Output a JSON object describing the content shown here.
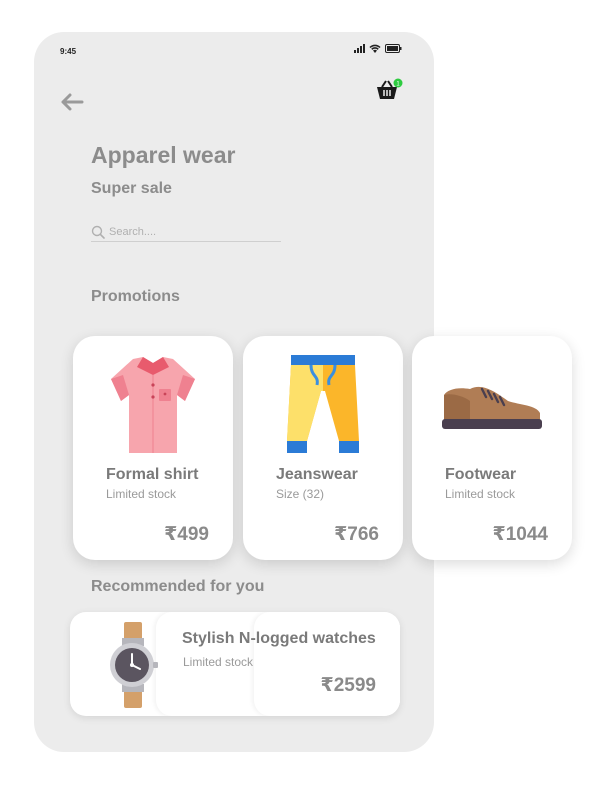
{
  "status_bar": {
    "time": "9:45",
    "icons": [
      "signal-icon",
      "wifi-icon",
      "battery-icon"
    ]
  },
  "header": {
    "back_icon": "back-arrow-icon",
    "cart_icon": "basket-icon",
    "cart_badge": "1",
    "badge_color": "#2ecc40"
  },
  "title": "Apparel wear",
  "subtitle": "Super sale",
  "search": {
    "placeholder": "Search....",
    "icon": "search-icon"
  },
  "promotions": {
    "heading": "Promotions",
    "items": [
      {
        "name": "Formal shirt",
        "meta": "Limited stock",
        "price": "₹499",
        "icon": "shirt-icon"
      },
      {
        "name": "Jeanswear",
        "meta": "Size (32)",
        "price": "₹766",
        "icon": "jeans-icon"
      },
      {
        "name": "Footwear",
        "meta": "Limited stock",
        "price": "₹1044",
        "icon": "shoe-icon"
      }
    ]
  },
  "recommended": {
    "heading": "Recommended for you",
    "items": [
      {
        "name": "Stylish N-logged watches",
        "meta": "Limited stock",
        "price": "₹2599",
        "icon": "watch-icon"
      }
    ]
  }
}
